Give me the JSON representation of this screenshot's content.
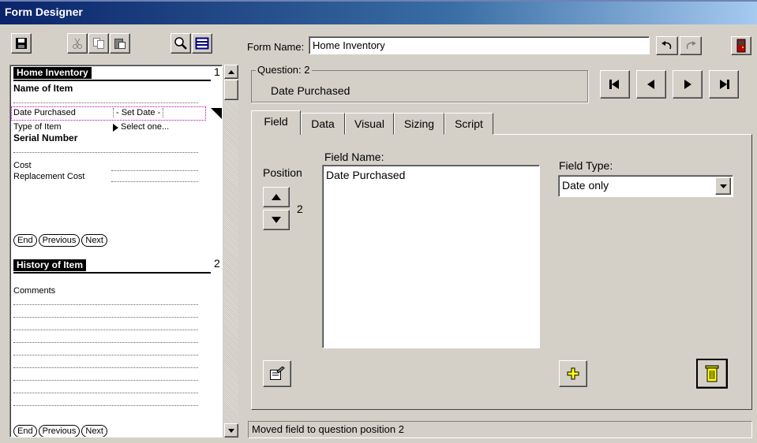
{
  "window": {
    "title": "Form Designer"
  },
  "header": {
    "form_name_label": "Form Name:",
    "form_name_value": "Home Inventory"
  },
  "form_preview": {
    "page1": {
      "number": "1",
      "title": "Home Inventory",
      "item_name_label": "Name of Item",
      "date_label": "Date Purchased",
      "date_value": "- Set Date -",
      "type_label": "Type of Item",
      "type_value": "Select one...",
      "serial_label": "Serial Number",
      "cost_label": "Cost",
      "replacement_label": "Replacement Cost",
      "buttons": [
        "End",
        "Previous",
        "Next"
      ]
    },
    "page2": {
      "number": "2",
      "title": "History of Item",
      "comments_label": "Comments",
      "buttons": [
        "End",
        "Previous",
        "Next"
      ]
    }
  },
  "question": {
    "label": "Question: 2",
    "name": "Date Purchased"
  },
  "tabs": [
    "Field",
    "Data",
    "Visual",
    "Sizing",
    "Script"
  ],
  "field_tab": {
    "position_label": "Position",
    "position_value": "2",
    "field_name_label": "Field Name:",
    "field_name_value": "Date Purchased",
    "field_type_label": "Field Type:",
    "field_type_value": "Date only"
  },
  "status": {
    "message": "Moved field to question position 2"
  }
}
